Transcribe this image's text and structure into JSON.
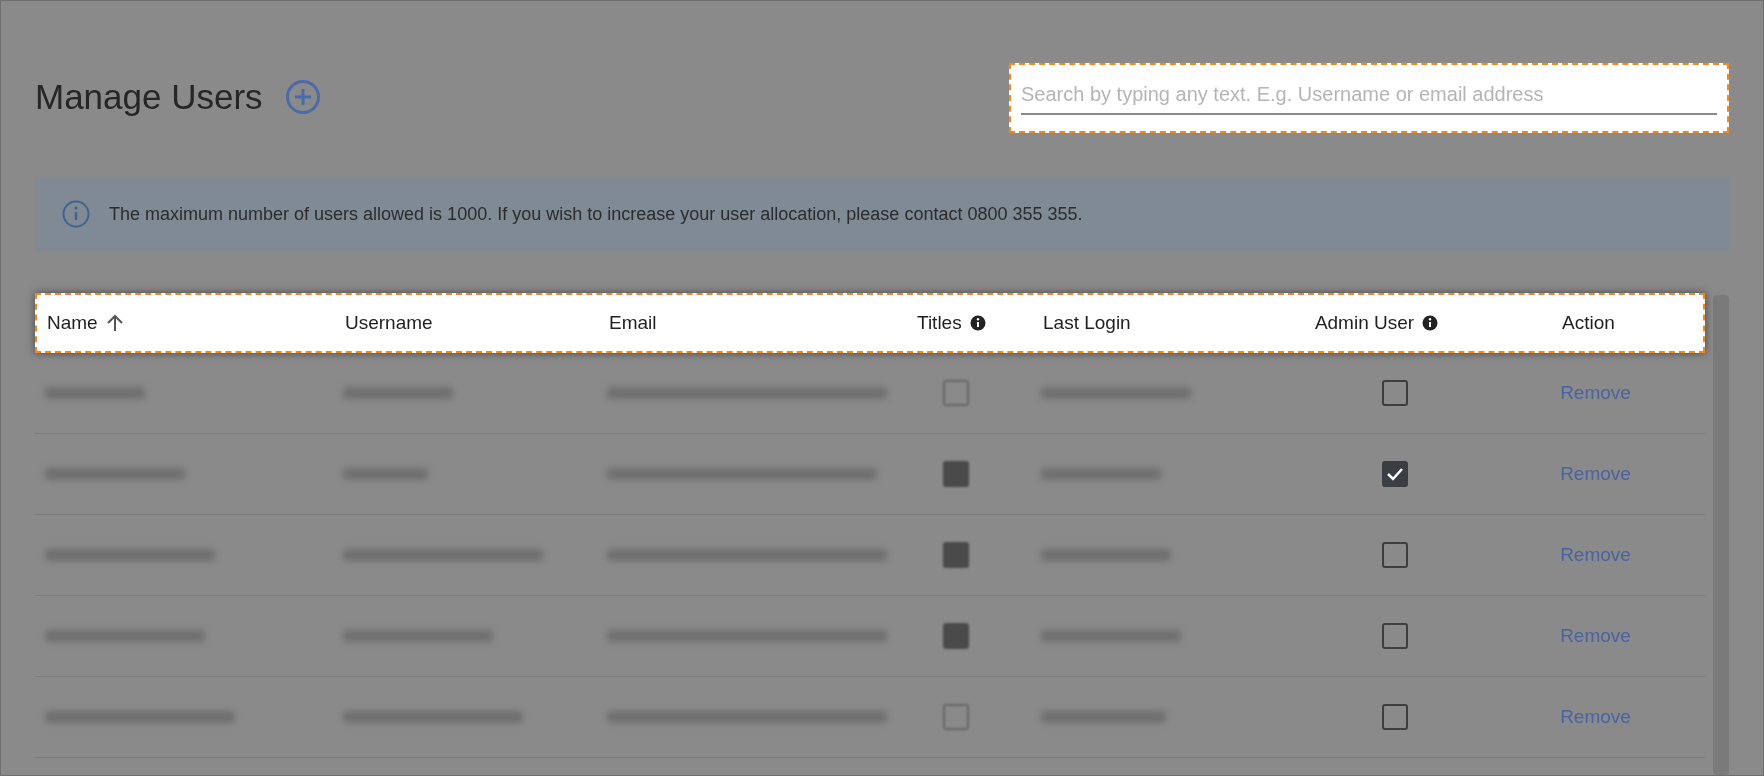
{
  "page": {
    "title": "Manage Users"
  },
  "search": {
    "placeholder": "Search by typing any text. E.g. Username or email address"
  },
  "notice": {
    "text": "The maximum number of users allowed is 1000. If you wish to increase your user allocation, please contact 0800 355 355."
  },
  "table": {
    "columns": [
      {
        "label": "Name",
        "sorted": true,
        "info": false
      },
      {
        "label": "Username",
        "sorted": false,
        "info": false
      },
      {
        "label": "Email",
        "sorted": false,
        "info": false
      },
      {
        "label": "Titles",
        "sorted": false,
        "info": true
      },
      {
        "label": "Last Login",
        "sorted": false,
        "info": false
      },
      {
        "label": "Admin User",
        "sorted": false,
        "info": true
      },
      {
        "label": "Action",
        "sorted": false,
        "info": false
      }
    ],
    "rows": [
      {
        "titles_checked": false,
        "admin_checked": false,
        "action": "Remove"
      },
      {
        "titles_checked": true,
        "admin_checked": true,
        "action": "Remove"
      },
      {
        "titles_checked": true,
        "admin_checked": false,
        "action": "Remove"
      },
      {
        "titles_checked": true,
        "admin_checked": false,
        "action": "Remove"
      },
      {
        "titles_checked": false,
        "admin_checked": false,
        "action": "Remove"
      }
    ]
  }
}
